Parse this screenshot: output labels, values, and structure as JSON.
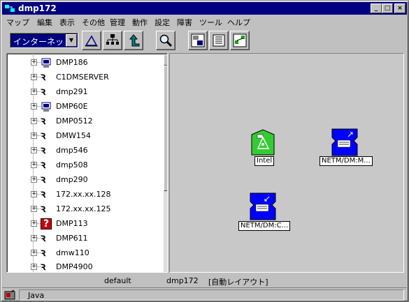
{
  "window": {
    "title": "dmp172"
  },
  "menu": [
    "マップ",
    "編集",
    "表示",
    "その他",
    "管理",
    "動作",
    "設定",
    "障害",
    "ツール",
    "ヘルプ"
  ],
  "toolbar": {
    "network_select": "インターネット",
    "tools": [
      "triangle-tool-icon",
      "hierarchy-icon",
      "up-arrow-icon",
      "magnifier-icon",
      "server-list-icon",
      "panel-icon",
      "diagram-icon"
    ]
  },
  "tree": {
    "items": [
      {
        "label": "DMP186",
        "icon": "computer-icon"
      },
      {
        "label": "C1DMSERVER",
        "icon": "network-node-icon"
      },
      {
        "label": "dmp291",
        "icon": "network-node-icon"
      },
      {
        "label": "DMP60E",
        "icon": "computer-icon"
      },
      {
        "label": "DMP0512",
        "icon": "network-node-icon"
      },
      {
        "label": "DMW154",
        "icon": "network-node-icon"
      },
      {
        "label": "dmp546",
        "icon": "network-node-icon"
      },
      {
        "label": "dmp508",
        "icon": "network-node-icon"
      },
      {
        "label": "dmp290",
        "icon": "network-node-icon"
      },
      {
        "label": "172.xx.xx.128",
        "icon": "network-node-icon"
      },
      {
        "label": "172.xx.xx.125",
        "icon": "network-node-icon"
      },
      {
        "label": "DMP113",
        "icon": "alert-node-icon"
      },
      {
        "label": "DMP611",
        "icon": "network-node-icon"
      },
      {
        "label": "dmw110",
        "icon": "network-node-icon"
      },
      {
        "label": "DMP4900",
        "icon": "network-node-icon"
      }
    ]
  },
  "map": {
    "nodes": [
      {
        "label": "Intel",
        "icon": "green-router-icon"
      },
      {
        "label": "NETM/DM:M...",
        "icon": "blue-server-icon"
      },
      {
        "label": "NETM/DM:C...",
        "icon": "blue-server-icon"
      }
    ]
  },
  "info": {
    "map_name": "default",
    "host": "dmp172",
    "layout": "[自動レイアウト]"
  },
  "status": {
    "text": "Java"
  },
  "colors": {
    "title_bar": "#000080",
    "green_node": "#33cc33",
    "blue_node": "#0000ff",
    "alert_node": "#cc0000"
  }
}
